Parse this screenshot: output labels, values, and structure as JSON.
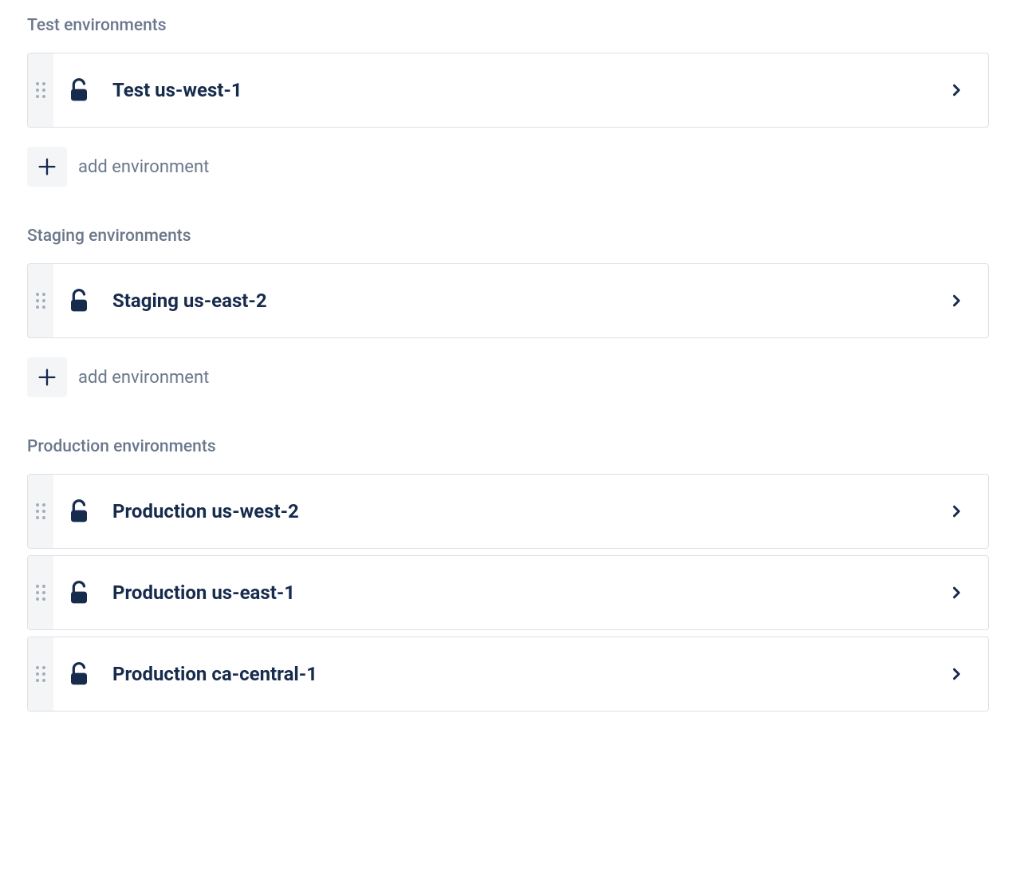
{
  "sections": [
    {
      "title": "Test environments",
      "environments": [
        {
          "name": "Test us-west-1",
          "locked": false
        }
      ],
      "add_label": "add environment",
      "show_add": true
    },
    {
      "title": "Staging environments",
      "environments": [
        {
          "name": "Staging us-east-2",
          "locked": false
        }
      ],
      "add_label": "add environment",
      "show_add": true
    },
    {
      "title": "Production environments",
      "environments": [
        {
          "name": "Production us-west-2",
          "locked": false
        },
        {
          "name": "Production us-east-1",
          "locked": false
        },
        {
          "name": "Production ca-central-1",
          "locked": false
        }
      ],
      "add_label": "add environment",
      "show_add": false
    }
  ]
}
